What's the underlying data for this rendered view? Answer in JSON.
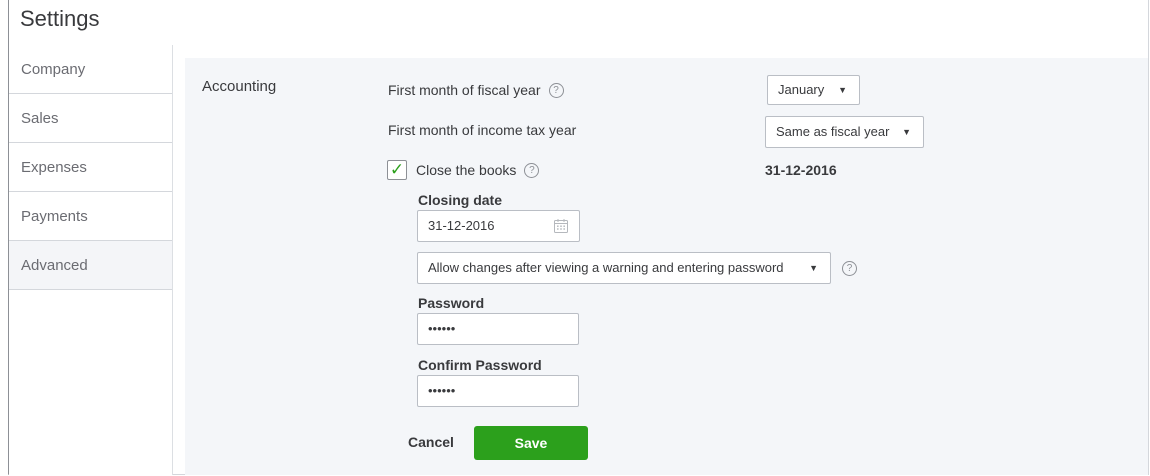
{
  "header": {
    "title": "Settings"
  },
  "sidebar": {
    "items": [
      {
        "label": "Company"
      },
      {
        "label": "Sales"
      },
      {
        "label": "Expenses"
      },
      {
        "label": "Payments"
      },
      {
        "label": "Advanced"
      }
    ],
    "active_index": 4
  },
  "accounting": {
    "section_label": "Accounting",
    "fiscal_year": {
      "label": "First month of fiscal year",
      "value": "January"
    },
    "tax_year": {
      "label": "First month of income tax year",
      "value": "Same as fiscal year"
    },
    "close_books": {
      "label": "Close the books",
      "checked": true,
      "summary_value": "31-12-2016",
      "closing_date_label": "Closing date",
      "closing_date_value": "31-12-2016",
      "mode_value": "Allow changes after viewing a warning and entering password",
      "password_label": "Password",
      "password_value": "••••••",
      "confirm_label": "Confirm Password",
      "confirm_value": "••••••"
    },
    "actions": {
      "cancel_label": "Cancel",
      "save_label": "Save"
    }
  },
  "colors": {
    "accent": "#2ca01c",
    "text": "#393a3d",
    "panel_bg": "#f4f6f9"
  }
}
